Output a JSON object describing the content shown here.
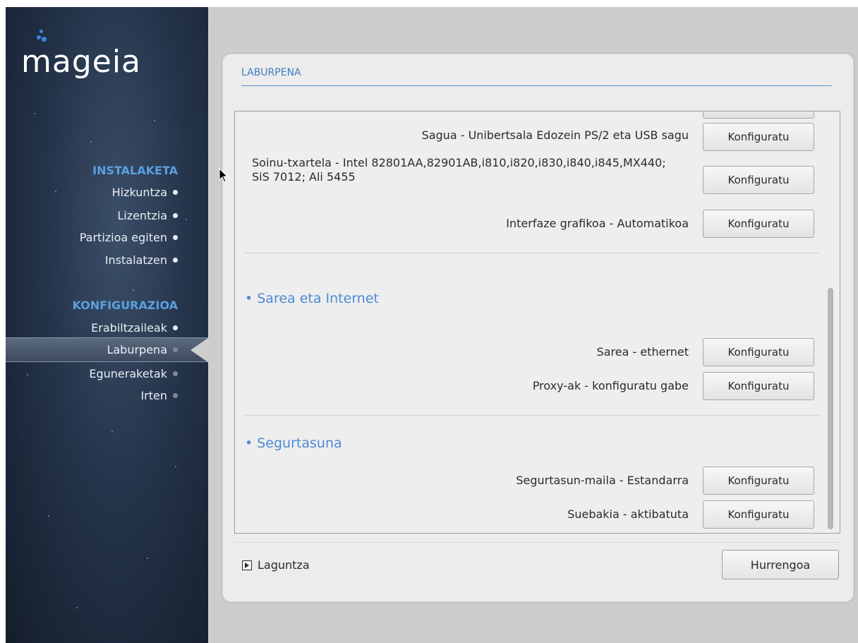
{
  "brand": {
    "logo_text": "mageia",
    "logo_dot_color": "#3d86d6"
  },
  "sidebar": {
    "sections": [
      {
        "title": "INSTALAKETA",
        "items": [
          {
            "label": "Hizkuntza",
            "state": "done"
          },
          {
            "label": "Lizentzia",
            "state": "done"
          },
          {
            "label": "Partizioa egiten",
            "state": "done"
          },
          {
            "label": "Instalatzen",
            "state": "done"
          }
        ]
      },
      {
        "title": "KONFIGURAZIOA",
        "items": [
          {
            "label": "Erabiltzaileak",
            "state": "done"
          },
          {
            "label": "Laburpena",
            "state": "active"
          },
          {
            "label": "Eguneraketak",
            "state": "pending"
          },
          {
            "label": "Irten",
            "state": "pending"
          }
        ]
      }
    ]
  },
  "panel": {
    "title": "LABURPENA",
    "rows_top": [
      {
        "label": "Sagua - Unibertsala Edozein PS/2 eta USB sagu",
        "button": "Konfiguratu"
      },
      {
        "label": "Soinu-txartela - Intel 82801AA,82901AB,i810,i820,i830,i840,i845,MX440; SiS 7012; Ali 5455",
        "button": "Konfiguratu"
      },
      {
        "label": "Interfaze grafikoa - Automatikoa",
        "button": "Konfiguratu"
      }
    ],
    "network": {
      "category": "• Sarea eta Internet",
      "rows": [
        {
          "label": "Sarea - ethernet",
          "button": "Konfiguratu"
        },
        {
          "label": "Proxy-ak - konfiguratu gabe",
          "button": "Konfiguratu"
        }
      ]
    },
    "security": {
      "category": "• Segurtasuna",
      "rows": [
        {
          "label": "Segurtasun-maila - Estandarra",
          "button": "Konfiguratu"
        },
        {
          "label": "Suebakia - aktibatuta",
          "button": "Konfiguratu"
        }
      ]
    },
    "help_label": "Laguntza",
    "next_label": "Hurrengoa"
  },
  "colors": {
    "accent": "#4c8ad6",
    "sidebar_title": "#5aa0e0",
    "panel_bg": "#ececec"
  }
}
